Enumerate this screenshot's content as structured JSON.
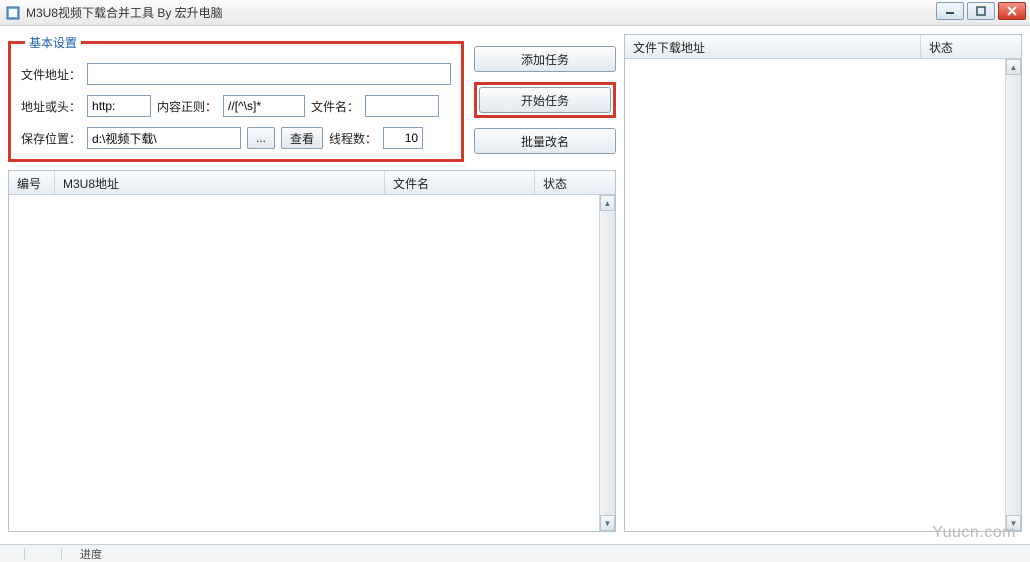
{
  "window": {
    "title": "M3U8视频下载合并工具 By 宏升电脑"
  },
  "basic": {
    "legend": "基本设置",
    "file_url_label": "文件地址：",
    "file_url_value": "",
    "head_label": "地址或头：",
    "head_value": "http:",
    "regex_label": "内容正则：",
    "regex_value": "//[^\\s]*",
    "filename_label": "文件名：",
    "filename_value": "",
    "savepath_label": "保存位置：",
    "savepath_value": "d:\\视频下载\\",
    "browse_btn": "...",
    "view_btn": "查看",
    "threads_label": "线程数：",
    "threads_value": "10"
  },
  "actions": {
    "add": "添加任务",
    "start": "开始任务",
    "rename": "批量改名"
  },
  "task_list": {
    "col_no": "编号",
    "col_url": "M3U8地址",
    "col_filename": "文件名",
    "col_status": "状态"
  },
  "right_list": {
    "col_addr": "文件下载地址",
    "col_status": "状态"
  },
  "status": {
    "cur_task": "",
    "cur_dl": "",
    "progress_label": "进度"
  },
  "watermark": "Yuucn.com"
}
